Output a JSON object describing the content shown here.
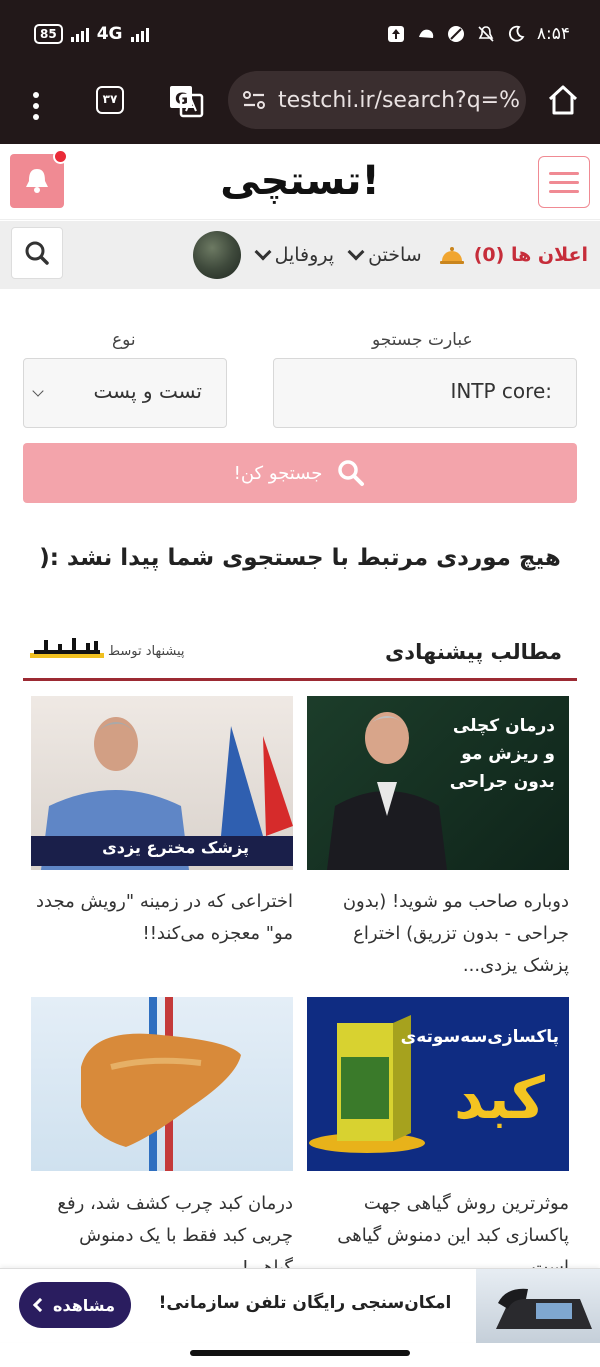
{
  "status_bar": {
    "battery": "85",
    "network": "4G",
    "time": "۸:۵۴"
  },
  "browser": {
    "tab_count": "۳۷",
    "url": "testchi.ir/search?q=%"
  },
  "site": {
    "logo_text": "تستچی!"
  },
  "nav": {
    "profile": "پروفایل",
    "build": "ساختن",
    "notifications": "اعلان ها (0)"
  },
  "search_form": {
    "query_label": "عبارت جستجو",
    "query_value": "INTP core:",
    "type_label": "نوع",
    "type_value": "تست و پست",
    "submit": "جستجو کن!"
  },
  "results": {
    "empty_message": "هیچ موردی مرتبط با جستجوی شما پیدا نشد :("
  },
  "suggestions": {
    "title": "مطالب پیشنهادی",
    "by": "پیشنهاد توسط",
    "cards": [
      {
        "text": "دوباره صاحب مو شوید! (بدون جراحی - بدون تزریق) اختراع پزشک یزدی...",
        "image_caption_lines": [
          "درمان کچلی",
          "و ریزش مو",
          "بدون جراحی"
        ]
      },
      {
        "text": "اختراعی که در زمینه \"رویش مجدد مو\" معجزه می‌کند!!",
        "image_caption_lines": [
          "پزشک مخترع یزدی"
        ]
      },
      {
        "text": "موثرترین روش گیاهی جهت پاکسازی کبد این دمنوش گیاهی است",
        "image_caption_lines": [
          "پاکسازی‌سه‌سوته‌ی",
          "کبد"
        ]
      },
      {
        "text": "درمان کبد چرب کشف شد، رفع چربی کبد فقط با یک دمنوش گیاهی!",
        "image_caption_lines": []
      }
    ]
  },
  "ad": {
    "text": "امکان‌سنجی رایگان تلفن سازمانی!",
    "button": "مشاهده"
  },
  "colors": {
    "brand_pink": "#f08a93",
    "button_pink": "#f3a4ab",
    "notif_red": "#c62d3a",
    "divider": "#9c2a33",
    "status_bg": "#221819"
  }
}
